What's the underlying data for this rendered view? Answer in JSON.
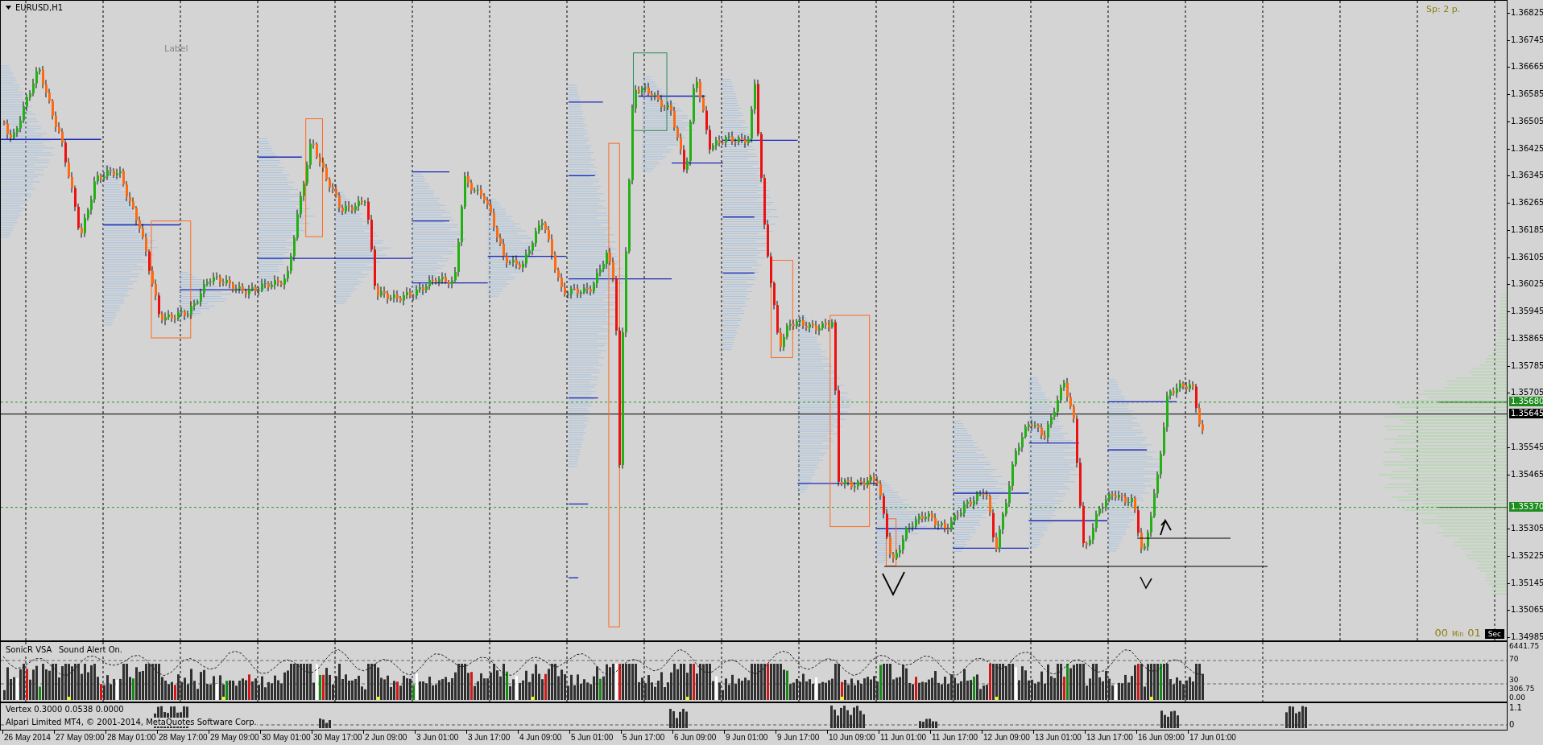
{
  "chart": {
    "title": "EURUSD,H1",
    "label": "Label",
    "spread": "Sp: 2 p.",
    "price_axis": [
      "1.36825",
      "1.36745",
      "1.36665",
      "1.36585",
      "1.36505",
      "1.36425",
      "1.36345",
      "1.36265",
      "1.36185",
      "1.36105",
      "1.36025",
      "1.35945",
      "1.35865",
      "1.35785",
      "1.35705",
      "1.35545",
      "1.35465",
      "1.35305",
      "1.35225",
      "1.35145",
      "1.35065",
      "1.34985"
    ],
    "price_tags": [
      {
        "text": "1.35680",
        "kind": "level"
      },
      {
        "text": "1.35645",
        "kind": "bid"
      },
      {
        "text": "1.35370",
        "kind": "level"
      }
    ],
    "timer": {
      "minutes": "00",
      "minutes_unit": "Min",
      "seconds": "01",
      "seconds_unit": "Sec"
    }
  },
  "indicators": [
    {
      "title": "SonicR VSA",
      "note": "Sound Alert On.",
      "axis": [
        "6441.75",
        "70",
        "30",
        "306.75",
        "0.00"
      ]
    },
    {
      "title": "Vertex 0.3000 0.0538 0.0000",
      "note": "Alpari Limited MT4, © 2001-2014, MetaQuotes Software Corp.",
      "axis": [
        "1.1",
        "0"
      ]
    }
  ],
  "time_axis": [
    "26 May 2014",
    "27 May 09:00",
    "28 May 01:00",
    "28 May 17:00",
    "29 May 09:00",
    "30 May 01:00",
    "30 May 17:00",
    "2 Jun 09:00",
    "3 Jun 01:00",
    "3 Jun 17:00",
    "4 Jun 09:00",
    "5 Jun 01:00",
    "5 Jun 17:00",
    "6 Jun 09:00",
    "9 Jun 01:00",
    "9 Jun 17:00",
    "10 Jun 09:00",
    "11 Jun 01:00",
    "11 Jun 17:00",
    "12 Jun 09:00",
    "13 Jun 01:00",
    "13 Jun 17:00",
    "16 Jun 09:00",
    "17 Jun 01:00"
  ]
}
